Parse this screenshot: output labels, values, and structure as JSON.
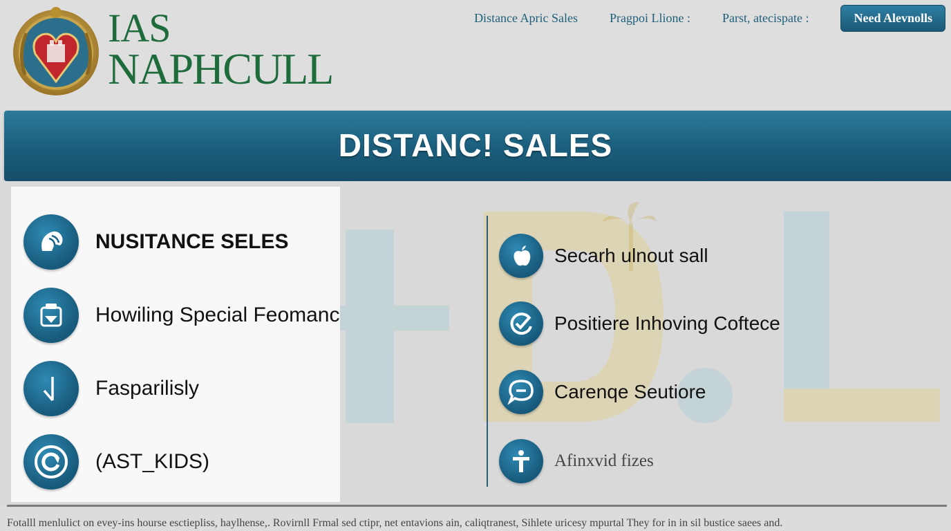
{
  "header": {
    "logo_line1": "IAS",
    "logo_line2": "NAPHCULL",
    "nav": [
      {
        "label": "Distance Apric Sales"
      },
      {
        "label": "Pragpoi Llione :"
      },
      {
        "label": "Parst, atecispate :"
      }
    ],
    "cta_label": "Need Alevnolls"
  },
  "banner": {
    "title": "DISTANC! SALES"
  },
  "left_panel": {
    "items": [
      {
        "label": "NUSITANCE SELES",
        "icon": "horse-head-icon"
      },
      {
        "label": "Howiling Special Feomanc",
        "icon": "shopping-basket-icon"
      },
      {
        "label": "Fasparilisly",
        "icon": "arrow-down-icon"
      },
      {
        "label": "(AST_KIDS)",
        "icon": "refresh-circle-icon"
      }
    ]
  },
  "right_panel": {
    "items": [
      {
        "label": "Secarh ulnout sall",
        "icon": "apple-icon"
      },
      {
        "label": "Positiere Inhoving Coftece",
        "icon": "check-circle-icon"
      },
      {
        "label": "Carenqe Seutiore",
        "icon": "chat-bubble-icon"
      },
      {
        "label": "Afinxvid fizes",
        "icon": "info-t-icon"
      }
    ]
  },
  "footer": {
    "text": "Fotalll menlulict on evey-ins hourse esctiepliss, haylhense,. Rovirnll Frmal sed ctipr, net entavions ain, caliqtranest, Sihlete uricesy mpurtal They for in in sil bustice saees and."
  },
  "colors": {
    "brand_green": "#1e6b3c",
    "brand_blue": "#1a5d7b",
    "icon_blue": "#2f8ab3",
    "background": "#dcdcdc"
  }
}
